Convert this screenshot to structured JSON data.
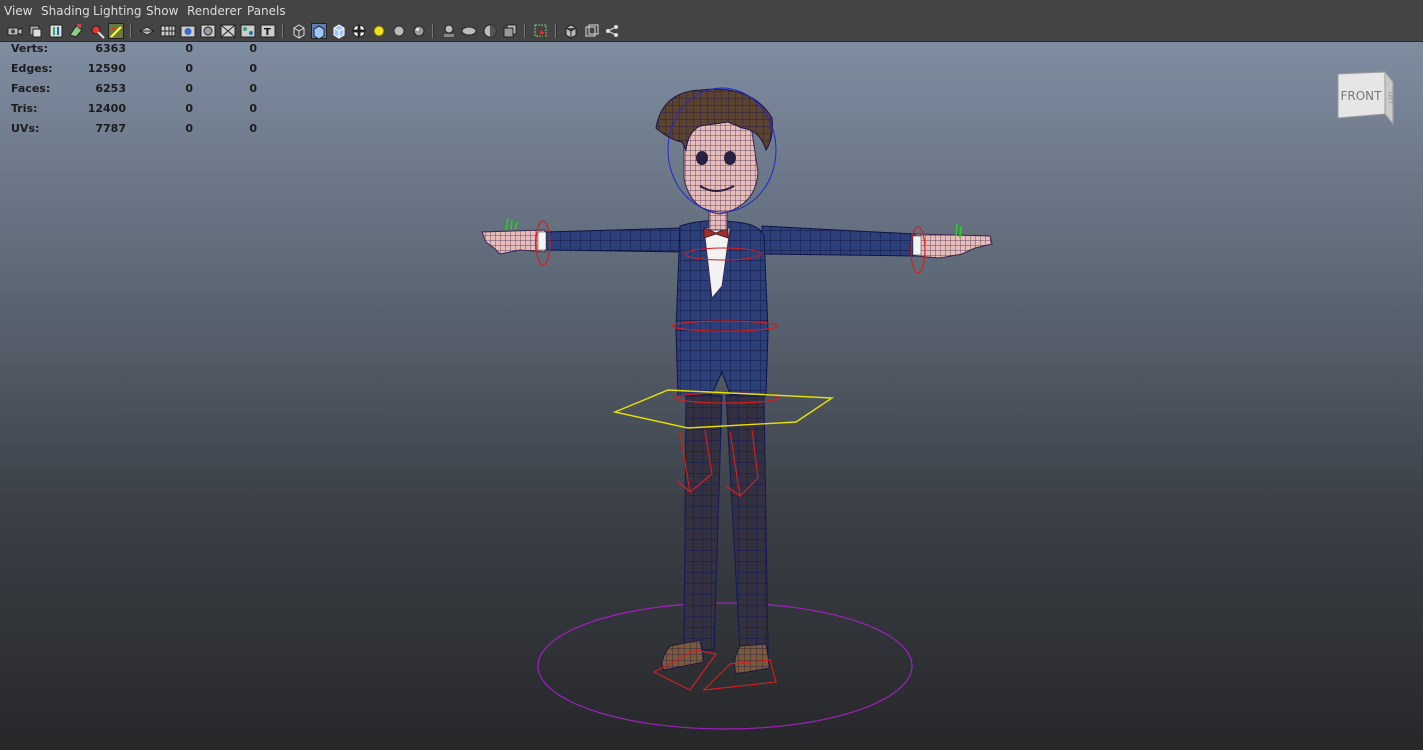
{
  "menubar": {
    "items": [
      "View",
      "Shading",
      "Lighting",
      "Show",
      "Renderer",
      "Panels"
    ]
  },
  "toolbar": {
    "icons": [
      "camera-attributes-icon",
      "camera-tools-icon",
      "bookmark-icon",
      "image-plane-icon",
      "2d-pan-icon",
      "grease-pencil-icon",
      "resolution-gate-icon",
      "grid-icon",
      "film-gate-icon",
      "field-chart-icon",
      "safe-action-icon",
      "safe-title-icon",
      "gate-mask-icon",
      "wireframe-icon",
      "smooth-shade-icon",
      "wireframe-on-shaded-icon",
      "textured-icon",
      "use-all-lights-icon",
      "shadows-icon",
      "screen-space-ao-icon",
      "motion-blur-icon",
      "anti-aliasing-icon",
      "depth-of-field-icon",
      "isolate-select-icon",
      "xray-icon",
      "xray-active-components-icon",
      "xray-joints-icon"
    ]
  },
  "hud": {
    "rows": [
      {
        "label": "Verts:",
        "c1": "6363",
        "c2": "0",
        "c3": "0"
      },
      {
        "label": "Edges:",
        "c1": "12590",
        "c2": "0",
        "c3": "0"
      },
      {
        "label": "Faces:",
        "c1": "6253",
        "c2": "0",
        "c3": "0"
      },
      {
        "label": "Tris:",
        "c1": "12400",
        "c2": "0",
        "c3": "0"
      },
      {
        "label": "UVs:",
        "c1": "7787",
        "c2": "0",
        "c3": "0"
      }
    ]
  },
  "viewcube": {
    "face_label": "FRONT",
    "side_label": "LEFT"
  },
  "colors": {
    "viewport_top": "#7f8da1",
    "viewport_bottom": "#262729",
    "ui_background": "#444444",
    "hud_text": "#1c1c1c",
    "wire_blue": "#1f2a8a",
    "control_red": "#d02020",
    "control_yellow": "#e8e000",
    "control_purple": "#a020c0"
  }
}
